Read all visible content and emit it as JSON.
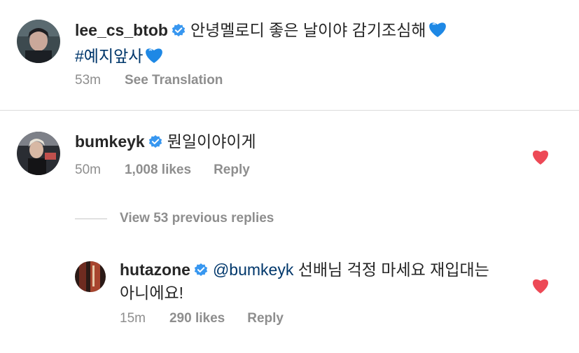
{
  "post": {
    "username": "lee_cs_btob",
    "caption_line1": "안녕멜로디 좋은 날이야 감기조심해",
    "hashtag": "#예지앞사",
    "emoji": "💙",
    "time": "53m",
    "see_translation": "See Translation"
  },
  "comment": {
    "username": "bumkeyk",
    "text": "뭔일이야이게",
    "time": "50m",
    "likes": "1,008 likes",
    "reply": "Reply"
  },
  "view_replies": "View 53 previous replies",
  "reply_comment": {
    "username": "hutazone",
    "mention": "@bumkeyk",
    "text_line1": " 선배님 걱정 마세요 재입대는",
    "text_line2": "아니에요!",
    "time": "15m",
    "likes": "290 likes",
    "reply": "Reply"
  },
  "colors": {
    "verified": "#3897f0",
    "heart": "#ed4956",
    "meta": "#8e8e8e",
    "hashtag": "#00376b",
    "emoji_heart": "#1e88e5"
  }
}
